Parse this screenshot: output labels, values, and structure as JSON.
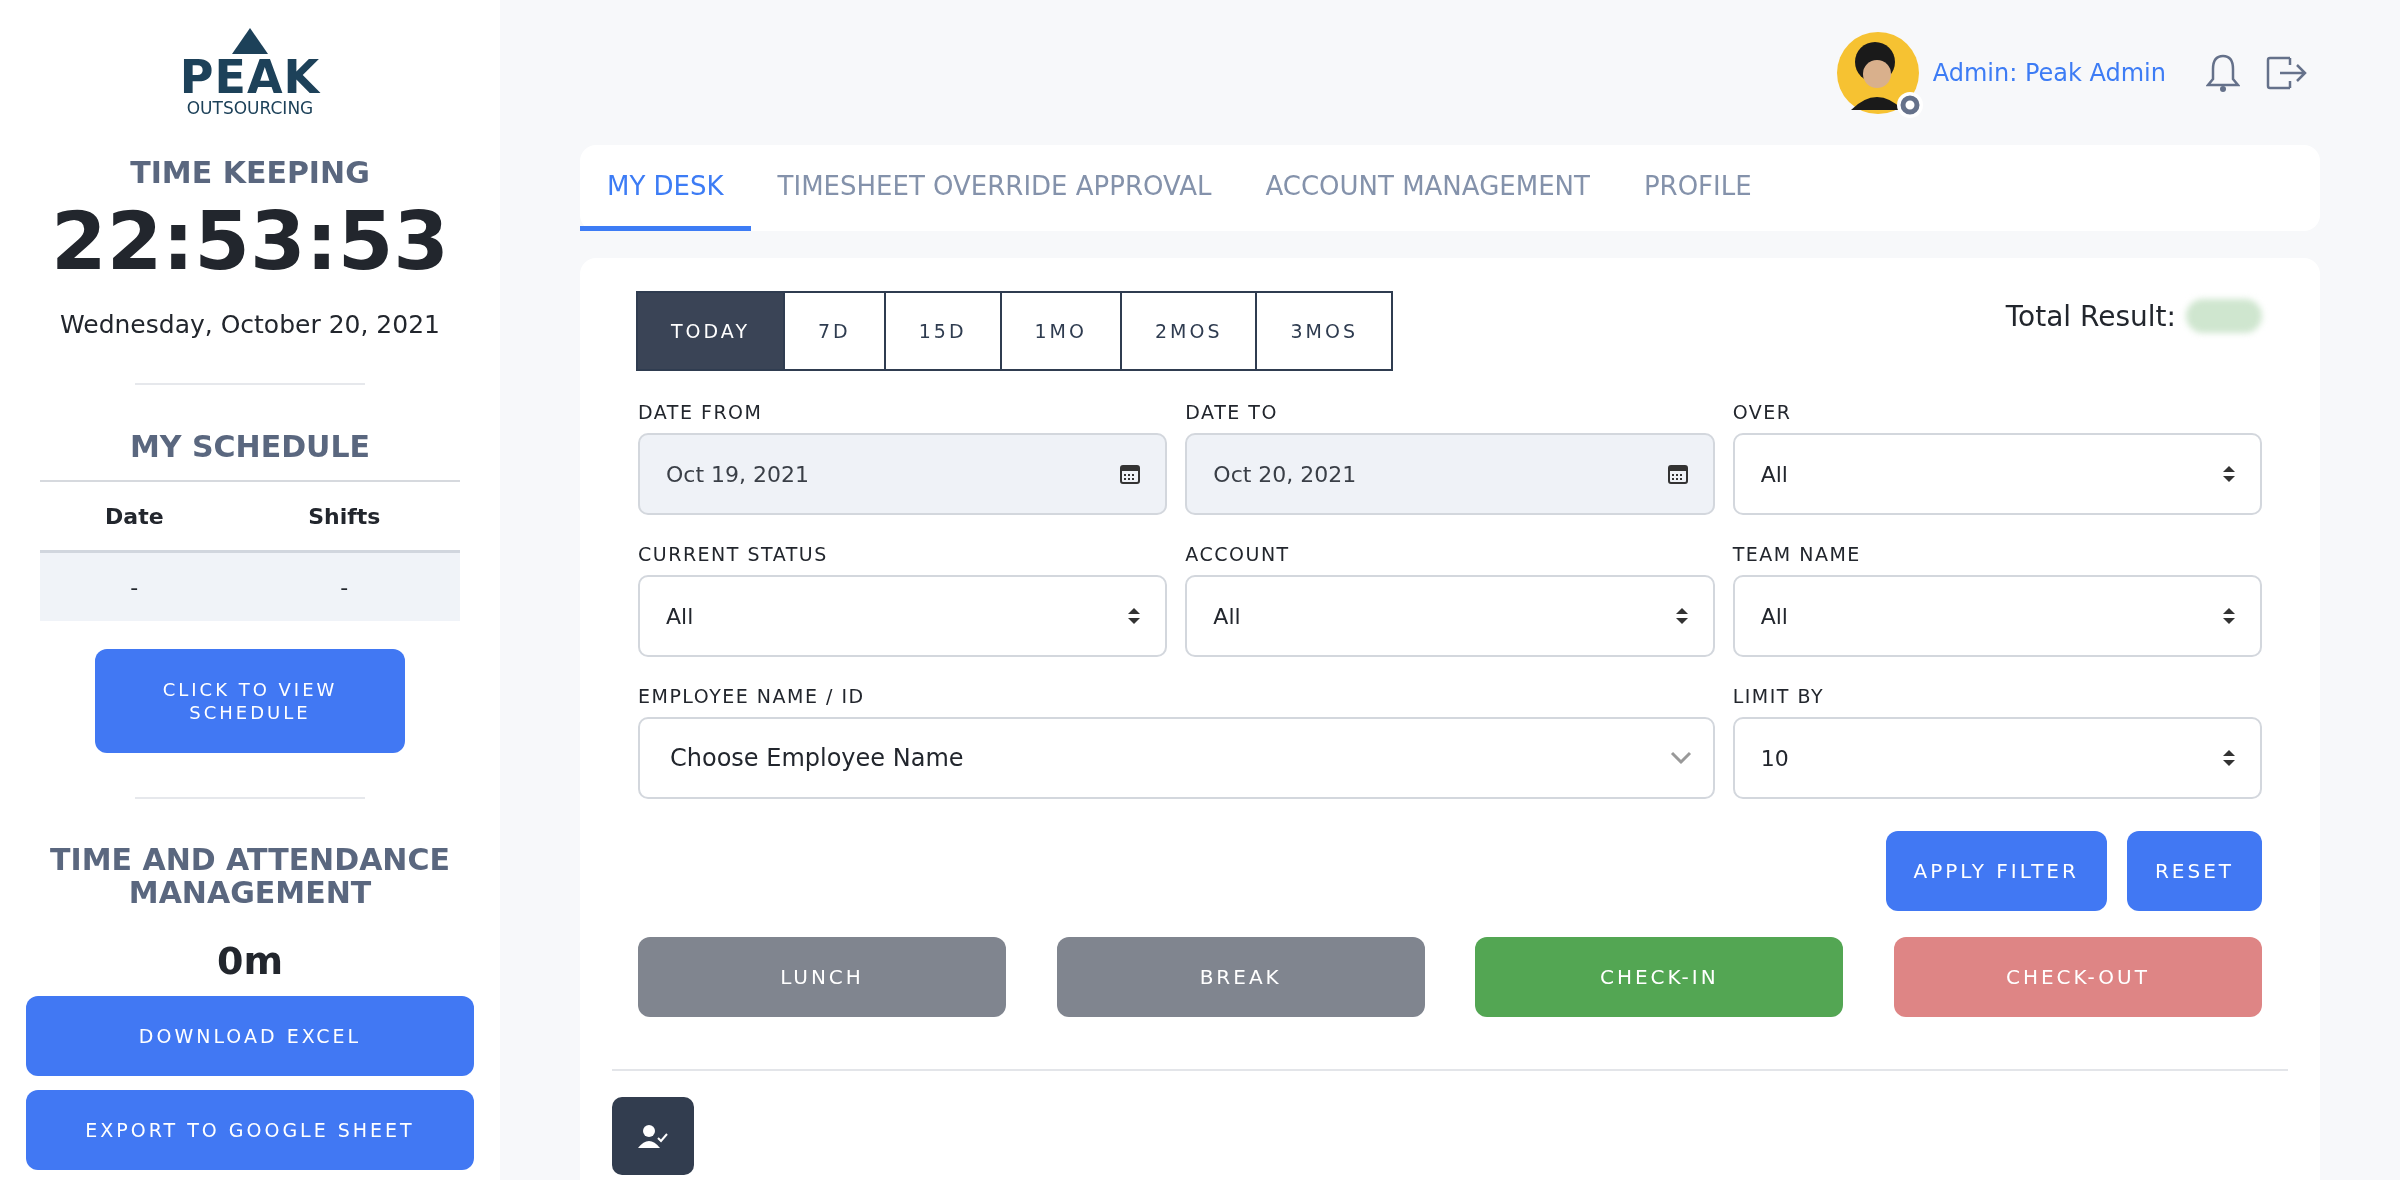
{
  "sidebar": {
    "logo": {
      "brand": "PEAK",
      "tagline": "OUTSOURCING"
    },
    "time_keeping": {
      "title": "TIME KEEPING",
      "clock": "22:53:53",
      "date": "Wednesday, October 20, 2021"
    },
    "schedule": {
      "title": "MY SCHEDULE",
      "columns": [
        "Date",
        "Shifts"
      ],
      "rows": [
        [
          "-",
          "-"
        ]
      ],
      "button": "CLICK TO VIEW SCHEDULE"
    },
    "attendance": {
      "title": "TIME AND ATTENDANCE MANAGEMENT",
      "value": "0m"
    },
    "buttons": [
      "DOWNLOAD EXCEL",
      "EXPORT TO GOOGLE SHEET"
    ]
  },
  "header": {
    "user_label": "Admin: Peak Admin"
  },
  "tabs": [
    {
      "label": "MY DESK",
      "selected": true
    },
    {
      "label": "TIMESHEET OVERRIDE APPROVAL",
      "selected": false
    },
    {
      "label": "ACCOUNT MANAGEMENT",
      "selected": false
    },
    {
      "label": "PROFILE",
      "selected": false
    }
  ],
  "filters": {
    "periods": [
      {
        "label": "TODAY",
        "selected": true
      },
      {
        "label": "7D",
        "selected": false
      },
      {
        "label": "15D",
        "selected": false
      },
      {
        "label": "1MO",
        "selected": false
      },
      {
        "label": "2MOS",
        "selected": false
      },
      {
        "label": "3MOS",
        "selected": false
      }
    ],
    "total_result_label": "Total Result:",
    "fields": [
      {
        "label": "DATE FROM",
        "kind": "date",
        "value": "Oct 19, 2021"
      },
      {
        "label": "DATE TO",
        "kind": "date",
        "value": "Oct 20, 2021"
      },
      {
        "label": "OVER",
        "kind": "select",
        "value": "All"
      },
      {
        "label": "CURRENT STATUS",
        "kind": "select",
        "value": "All"
      },
      {
        "label": "ACCOUNT",
        "kind": "select",
        "value": "All"
      },
      {
        "label": "TEAM NAME",
        "kind": "select",
        "value": "All"
      },
      {
        "label": "EMPLOYEE NAME / ID",
        "kind": "combo",
        "value": "Choose Employee Name"
      },
      {
        "label": "LIMIT BY",
        "kind": "select",
        "value": "10"
      }
    ],
    "filter_buttons": [
      "APPLY FILTER",
      "RESET"
    ],
    "actions": [
      {
        "label": "LUNCH",
        "kind": "lunch"
      },
      {
        "label": "BREAK",
        "kind": "break"
      },
      {
        "label": "CHECK-IN",
        "kind": "checkin"
      },
      {
        "label": "CHECK-OUT",
        "kind": "checkout"
      }
    ]
  }
}
